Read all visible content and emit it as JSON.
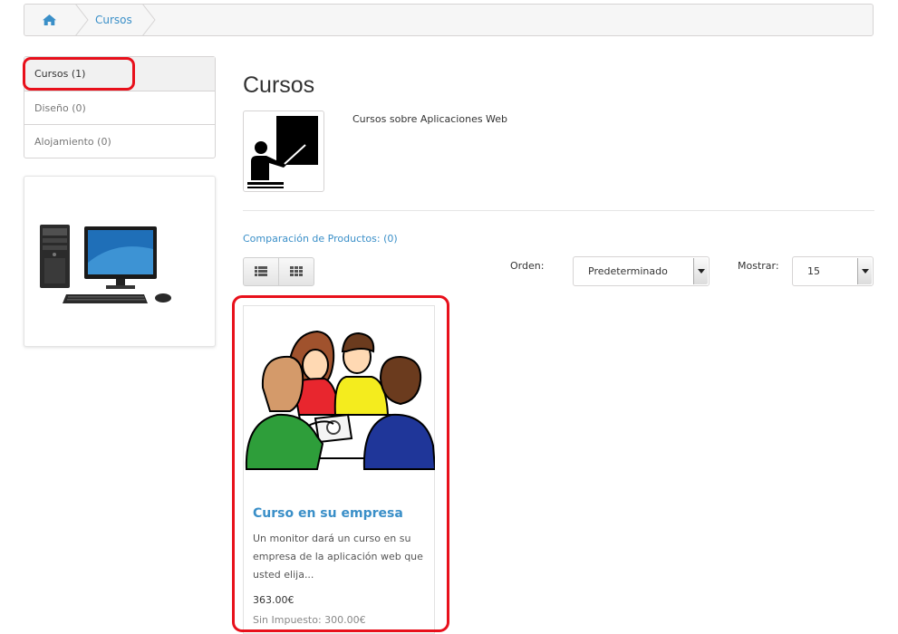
{
  "breadcrumb": {
    "home_icon": "home-icon",
    "items": [
      "Cursos"
    ]
  },
  "sidebar": {
    "categories": [
      {
        "label": "Cursos (1)"
      },
      {
        "label": "Diseño (0)"
      },
      {
        "label": "Alojamiento (0)"
      }
    ],
    "highlight_color": "#e8101b"
  },
  "category": {
    "title": "Cursos",
    "description": "Cursos sobre Aplicaciones Web"
  },
  "toolbar": {
    "compare_label": "Comparación de Productos: (0)",
    "view_icons": [
      "list-view-icon",
      "grid-view-icon"
    ],
    "order_label": "Orden:",
    "order_value": "Predeterminado",
    "show_label": "Mostrar:",
    "show_value": "15"
  },
  "products": [
    {
      "name": "Curso en su empresa",
      "description": "Un monitor dará un curso en su empresa de la aplicación web que usted elija...",
      "price": "363.00€",
      "price_without_tax": "Sin Impuesto: 300.00€"
    }
  ],
  "colors": {
    "link": "#3a8fc8",
    "highlight": "#e8101b"
  }
}
